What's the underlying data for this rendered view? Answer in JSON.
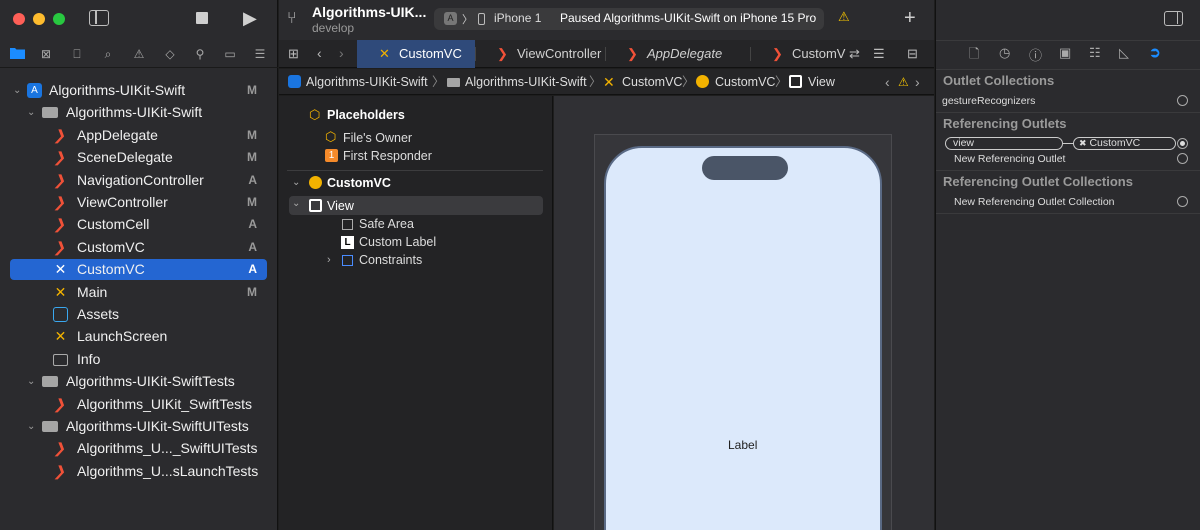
{
  "window": {
    "project_name": "Algorithms-UIK...",
    "branch": "develop",
    "run_destination": "iPhone 1",
    "status": "Paused Algorithms-UIKit-Swift on iPhone 15 Pro",
    "add_label": "+"
  },
  "tabs": [
    {
      "label": "CustomVC",
      "kind": "xib",
      "active": true
    },
    {
      "label": "ViewController",
      "kind": "swift",
      "active": false
    },
    {
      "label": "AppDelegate",
      "kind": "swift",
      "active": false
    },
    {
      "label": "CustomV",
      "kind": "swift",
      "active": false
    }
  ],
  "jumpbar": [
    "Algorithms-UIKit-Swift",
    "Algorithms-UIKit-Swift",
    "CustomVC",
    "CustomVC",
    "View"
  ],
  "navigator": {
    "items": [
      {
        "label": "Algorithms-UIKit-Swift",
        "badge": "M",
        "kind": "project",
        "depth": 0,
        "open": true
      },
      {
        "label": "Algorithms-UIKit-Swift",
        "badge": "",
        "kind": "folder",
        "depth": 1,
        "open": true
      },
      {
        "label": "AppDelegate",
        "badge": "M",
        "kind": "swift",
        "depth": 2
      },
      {
        "label": "SceneDelegate",
        "badge": "M",
        "kind": "swift",
        "depth": 2
      },
      {
        "label": "NavigationController",
        "badge": "A",
        "kind": "swift",
        "depth": 2
      },
      {
        "label": "ViewController",
        "badge": "M",
        "kind": "swift",
        "depth": 2
      },
      {
        "label": "CustomCell",
        "badge": "A",
        "kind": "swift",
        "depth": 2
      },
      {
        "label": "CustomVC",
        "badge": "A",
        "kind": "swift",
        "depth": 2
      },
      {
        "label": "CustomVC",
        "badge": "A",
        "kind": "xib",
        "depth": 2,
        "selected": true
      },
      {
        "label": "Main",
        "badge": "M",
        "kind": "xib",
        "depth": 2
      },
      {
        "label": "Assets",
        "badge": "",
        "kind": "assets",
        "depth": 2
      },
      {
        "label": "LaunchScreen",
        "badge": "",
        "kind": "xib",
        "depth": 2
      },
      {
        "label": "Info",
        "badge": "",
        "kind": "plist",
        "depth": 2
      },
      {
        "label": "Algorithms-UIKit-SwiftTests",
        "badge": "",
        "kind": "folder",
        "depth": 1,
        "open": true
      },
      {
        "label": "Algorithms_UIKit_SwiftTests",
        "badge": "",
        "kind": "swift",
        "depth": 2
      },
      {
        "label": "Algorithms-UIKit-SwiftUITests",
        "badge": "",
        "kind": "folder",
        "depth": 1,
        "open": true
      },
      {
        "label": "Algorithms_U..._SwiftUITests",
        "badge": "",
        "kind": "swift",
        "depth": 2
      },
      {
        "label": "Algorithms_U...sLaunchTests",
        "badge": "",
        "kind": "swift",
        "depth": 2
      }
    ]
  },
  "outline": {
    "placeholders": "Placeholders",
    "files_owner": "File's Owner",
    "first_responder": "First Responder",
    "custom_vc": "CustomVC",
    "view": "View",
    "safe_area": "Safe Area",
    "custom_label": "Custom Label",
    "constraints": "Constraints"
  },
  "canvas": {
    "label_text": "Label"
  },
  "inspector": {
    "outlet_collections": "Outlet Collections",
    "gesture_recognizers": "gestureRecognizers",
    "referencing_outlets": "Referencing Outlets",
    "outlet_view": "view",
    "outlet_target": "CustomVC",
    "new_referencing_outlet": "New Referencing Outlet",
    "referencing_outlet_collections": "Referencing Outlet Collections",
    "new_referencing_outlet_collection": "New Referencing Outlet Collection"
  },
  "colors": {
    "accent": "#2466d2",
    "swift": "#f05138",
    "xib": "#f2b200",
    "warning": "#f5c400"
  }
}
